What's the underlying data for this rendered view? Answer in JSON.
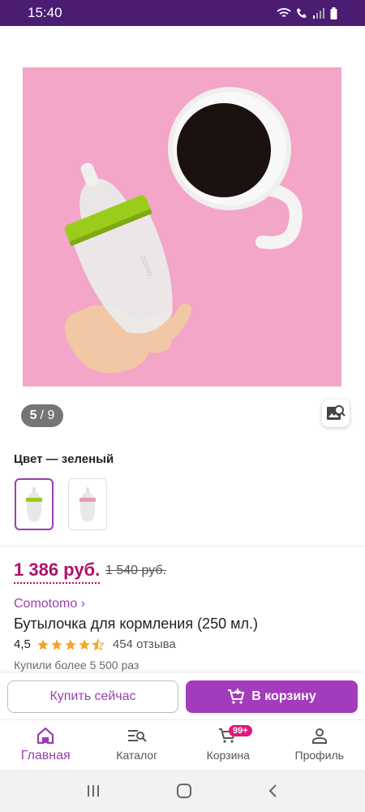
{
  "status_bar": {
    "time": "15:40"
  },
  "gallery": {
    "counter_current": "5",
    "counter_separator": "/ 9"
  },
  "color": {
    "label": "Цвет — зеленый"
  },
  "price": {
    "current": "1 386 руб.",
    "old": "1 540 руб."
  },
  "product": {
    "brand": "Comotomo ›",
    "title": "Бутылочка для кормления (250 мл.)",
    "rating": "4,5",
    "rating_value": 4.5,
    "reviews": "454 отзыва",
    "bought": "Купили более 5 500 раз"
  },
  "actions": {
    "buy_now": "Купить сейчас",
    "add_to_cart": "В корзину"
  },
  "nav": {
    "items": [
      {
        "label": "Главная",
        "icon": "home-icon"
      },
      {
        "label": "Каталог",
        "icon": "catalog-search-icon"
      },
      {
        "label": "Корзина",
        "icon": "cart-icon",
        "badge": "99+"
      },
      {
        "label": "Профиль",
        "icon": "profile-icon"
      }
    ]
  },
  "colors": {
    "accent": "#9b3fb0",
    "price": "#b0106a",
    "status_bar": "#4a1c72",
    "badge": "#e0177a"
  }
}
